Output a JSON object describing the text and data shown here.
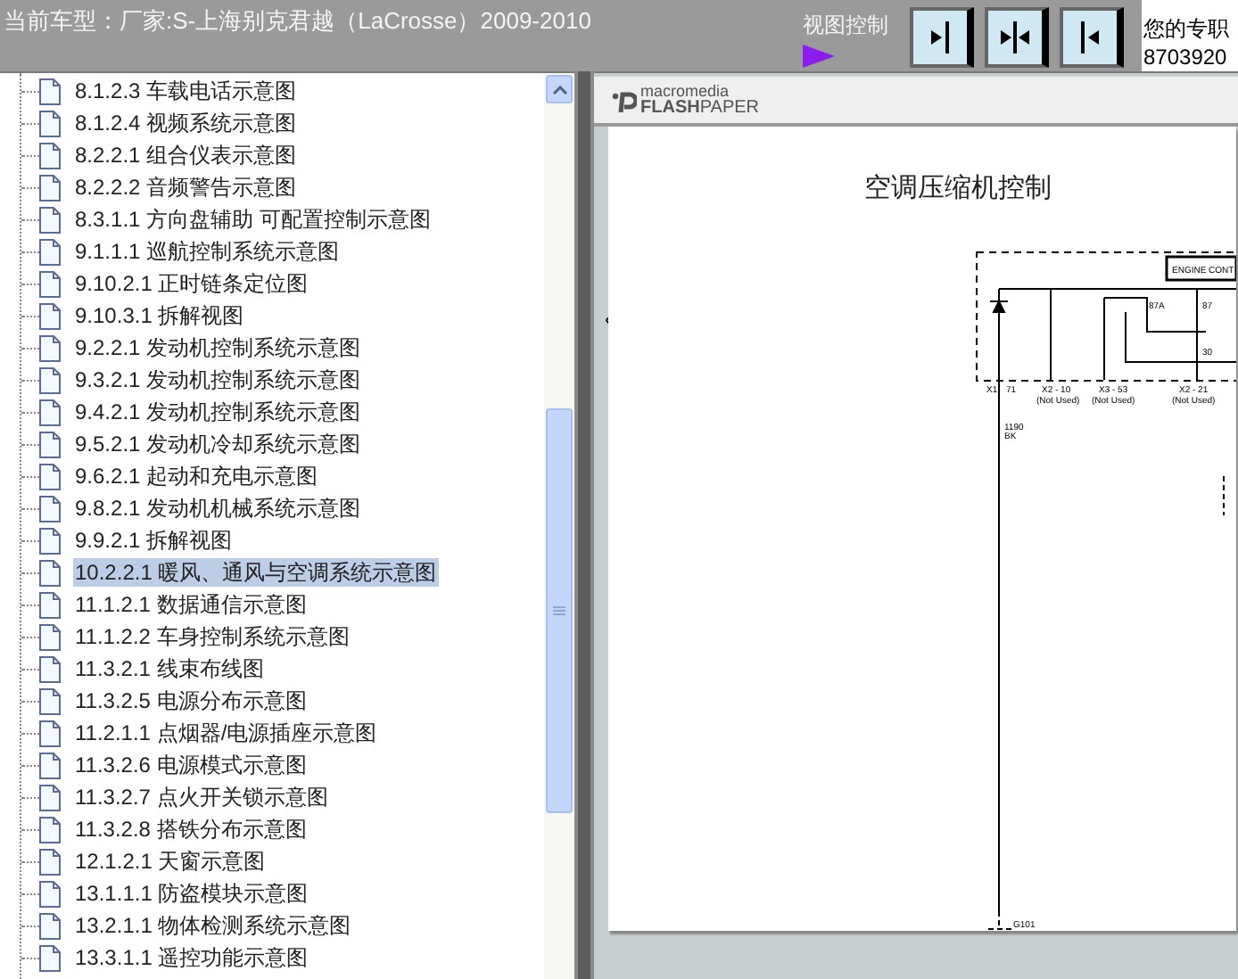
{
  "header": {
    "title": "当前车型：厂家:S-上海别克君越（LaCrosse）2009-2010",
    "view_control_label": "视图控制",
    "notice_lines": [
      "您的专职",
      "8703920"
    ]
  },
  "tree": {
    "items": [
      {
        "label": "8.1.2.3 车载电话示意图",
        "selected": false
      },
      {
        "label": "8.1.2.4 视频系统示意图",
        "selected": false
      },
      {
        "label": "8.2.2.1 组合仪表示意图",
        "selected": false
      },
      {
        "label": "8.2.2.2 音频警告示意图",
        "selected": false
      },
      {
        "label": "8.3.1.1 方向盘辅助 可配置控制示意图",
        "selected": false
      },
      {
        "label": "9.1.1.1 巡航控制系统示意图",
        "selected": false
      },
      {
        "label": "9.10.2.1 正时链条定位图",
        "selected": false
      },
      {
        "label": "9.10.3.1 拆解视图",
        "selected": false
      },
      {
        "label": "9.2.2.1 发动机控制系统示意图",
        "selected": false
      },
      {
        "label": "9.3.2.1 发动机控制系统示意图",
        "selected": false
      },
      {
        "label": "9.4.2.1 发动机控制系统示意图",
        "selected": false
      },
      {
        "label": "9.5.2.1 发动机冷却系统示意图",
        "selected": false
      },
      {
        "label": "9.6.2.1 起动和充电示意图",
        "selected": false
      },
      {
        "label": "9.8.2.1 发动机机械系统示意图",
        "selected": false
      },
      {
        "label": "9.9.2.1 拆解视图",
        "selected": false
      },
      {
        "label": "10.2.2.1 暖风、通风与空调系统示意图",
        "selected": true
      },
      {
        "label": "11.1.2.1 数据通信示意图",
        "selected": false
      },
      {
        "label": "11.1.2.2 车身控制系统示意图",
        "selected": false
      },
      {
        "label": "11.3.2.1 线束布线图",
        "selected": false
      },
      {
        "label": "11.3.2.5 电源分布示意图",
        "selected": false
      },
      {
        "label": "11.2.1.1 点烟器/电源插座示意图",
        "selected": false
      },
      {
        "label": "11.3.2.6 电源模式示意图",
        "selected": false
      },
      {
        "label": "11.3.2.7 点火开关锁示意图",
        "selected": false
      },
      {
        "label": "11.3.2.8 搭铁分布示意图",
        "selected": false
      },
      {
        "label": "12.1.2.1 天窗示意图",
        "selected": false
      },
      {
        "label": "13.1.1.1 防盗模块示意图",
        "selected": false
      },
      {
        "label": "13.2.1.1 物体检测系统示意图",
        "selected": false
      },
      {
        "label": "13.3.1.1 遥控功能示意图",
        "selected": false
      }
    ]
  },
  "viewer": {
    "logo_top": "macromedia",
    "logo_bold": "FLASH",
    "logo_rest": "PAPER",
    "page": {
      "title": "空调压缩机控制",
      "diagram_labels": [
        "ENGINE CONT",
        "87A",
        "87",
        "30",
        "X1",
        "71",
        "X2 - 10",
        "(Not Used)",
        "X3 - 53",
        "(Not Used)",
        "X2 - 21",
        "(Not Used)",
        "1190",
        "BK",
        "G101"
      ]
    }
  }
}
